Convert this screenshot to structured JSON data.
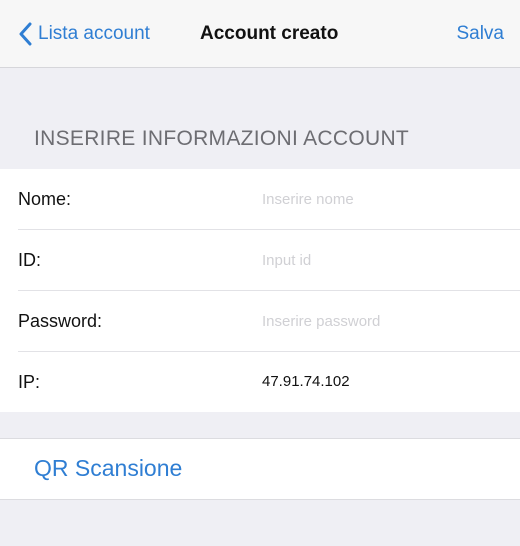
{
  "navbar": {
    "back_label": "Lista account",
    "title": "Account creato",
    "save_label": "Salva"
  },
  "section": {
    "header": "INSERIRE INFORMAZIONI ACCOUNT"
  },
  "form": {
    "rows": [
      {
        "label": "Nome:",
        "placeholder": "Inserire nome",
        "value": ""
      },
      {
        "label": "ID:",
        "placeholder": "Input id",
        "value": ""
      },
      {
        "label": "Password:",
        "placeholder": "Inserire password",
        "value": ""
      },
      {
        "label": "IP:",
        "value": "47.91.74.102"
      }
    ]
  },
  "qr": {
    "label": "QR Scansione"
  },
  "colors": {
    "accent": "#2f7ed3",
    "background": "#efeff4",
    "cell": "#ffffff",
    "section_text": "#6d6d72",
    "placeholder": "#d0d0d4"
  },
  "icons": {
    "back": "chevron-left-icon"
  }
}
